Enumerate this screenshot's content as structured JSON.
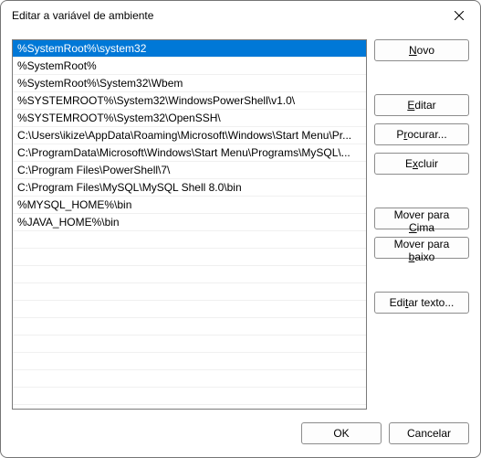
{
  "window": {
    "title": "Editar a variável de ambiente"
  },
  "list": {
    "items": [
      "%SystemRoot%\\system32",
      "%SystemRoot%",
      "%SystemRoot%\\System32\\Wbem",
      "%SYSTEMROOT%\\System32\\WindowsPowerShell\\v1.0\\",
      "%SYSTEMROOT%\\System32\\OpenSSH\\",
      "C:\\Users\\ikize\\AppData\\Roaming\\Microsoft\\Windows\\Start Menu\\Pr...",
      "C:\\ProgramData\\Microsoft\\Windows\\Start Menu\\Programs\\MySQL\\...",
      "C:\\Program Files\\PowerShell\\7\\",
      "C:\\Program Files\\MySQL\\MySQL Shell 8.0\\bin",
      "%MYSQL_HOME%\\bin",
      "%JAVA_HOME%\\bin"
    ],
    "selected_index": 0,
    "blank_rows": 10
  },
  "buttons": {
    "novo": {
      "pre": "",
      "key": "N",
      "post": "ovo"
    },
    "editar": {
      "pre": "",
      "key": "E",
      "post": "ditar"
    },
    "procurar": {
      "pre": "P",
      "key": "r",
      "post": "ocurar..."
    },
    "excluir": {
      "pre": "E",
      "key": "x",
      "post": "cluir"
    },
    "cima": {
      "pre": "Mover para ",
      "key": "C",
      "post": "ima"
    },
    "baixo": {
      "pre": "Mover para ",
      "key": "b",
      "post": "aixo"
    },
    "texto": {
      "pre": "Edi",
      "key": "t",
      "post": "ar texto..."
    },
    "ok": {
      "label": "OK"
    },
    "cancelar": {
      "label": "Cancelar"
    }
  }
}
